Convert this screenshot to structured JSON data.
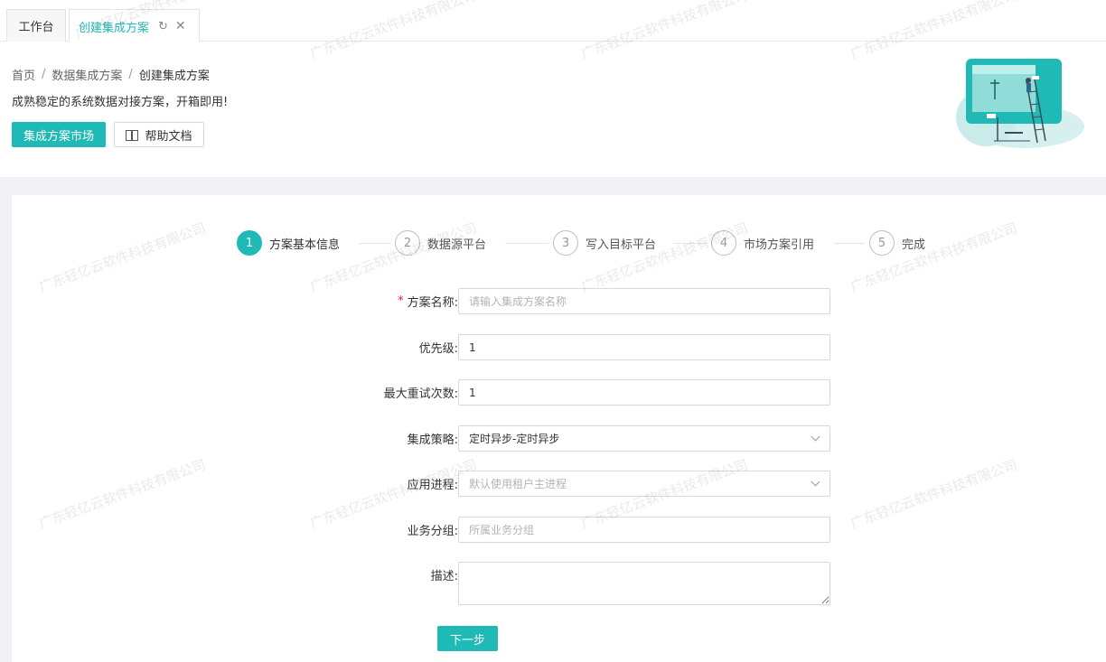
{
  "tabs": [
    {
      "label": "工作台",
      "active": false
    },
    {
      "label": "创建集成方案",
      "active": true
    }
  ],
  "breadcrumb": {
    "items": [
      "首页",
      "数据集成方案"
    ],
    "current": "创建集成方案",
    "separator": "/"
  },
  "header": {
    "subtitle": "成熟稳定的系统数据对接方案，开箱即用!",
    "market_button": "集成方案市场",
    "help_button": "帮助文档"
  },
  "steps": [
    {
      "num": "1",
      "label": "方案基本信息",
      "active": true
    },
    {
      "num": "2",
      "label": "数据源平台",
      "active": false
    },
    {
      "num": "3",
      "label": "写入目标平台",
      "active": false
    },
    {
      "num": "4",
      "label": "市场方案引用",
      "active": false
    },
    {
      "num": "5",
      "label": "完成",
      "active": false
    }
  ],
  "form": {
    "name": {
      "label": "方案名称:",
      "required_mark": "*",
      "placeholder": "请输入集成方案名称",
      "value": ""
    },
    "priority": {
      "label": "优先级:",
      "value": "1"
    },
    "max_retry": {
      "label": "最大重试次数:",
      "value": "1"
    },
    "strategy": {
      "label": "集成策略:",
      "value": "定时异步-定时异步"
    },
    "process": {
      "label": "应用进程:",
      "placeholder": "默认使用租户主进程"
    },
    "group": {
      "label": "业务分组:",
      "placeholder": "所属业务分组",
      "value": ""
    },
    "description": {
      "label": "描述:",
      "value": ""
    },
    "next_button": "下一步"
  },
  "watermark": "广东轻亿云软件科技有限公司",
  "colors": {
    "accent": "#1fbab5",
    "required": "#f5222d"
  }
}
